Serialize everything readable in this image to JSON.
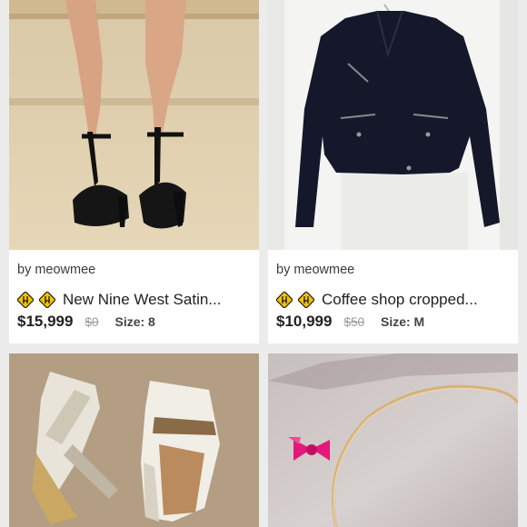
{
  "listings": [
    {
      "seller": "by meowmee",
      "title": "New Nine West Satin...",
      "price": "$15,999",
      "original_price": "$0",
      "size": "Size: 8",
      "photo": "black-satin-t-strap-heels"
    },
    {
      "seller": "by meowmee",
      "title": "Coffee shop cropped...",
      "price": "$10,999",
      "original_price": "$50",
      "size": "Size: M",
      "photo": "black-cropped-moto-jacket"
    },
    {
      "photo": "beige-espadrille-wedge-sandals"
    },
    {
      "photo": "gold-headband-with-pink-bow"
    }
  ],
  "icons": {
    "badge": "warning-sign-icon"
  },
  "colors": {
    "background": "#ececec",
    "card": "#ffffff",
    "badge_yellow": "#f5c300"
  }
}
